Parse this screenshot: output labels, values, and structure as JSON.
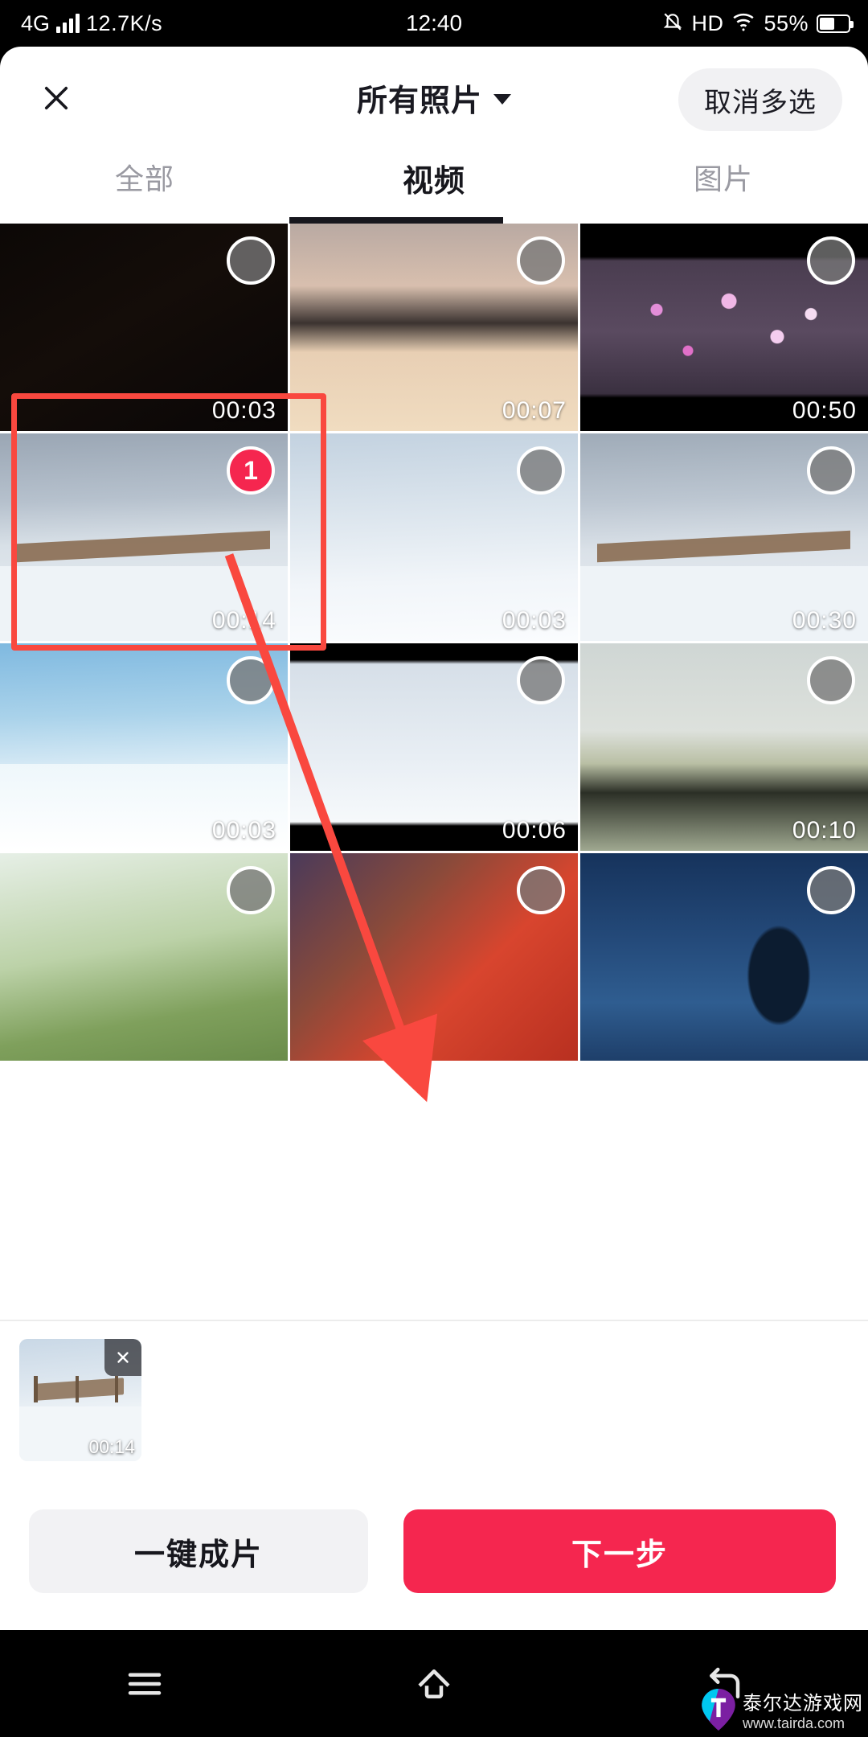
{
  "status_bar": {
    "network": "4G",
    "speed": "12.7K/s",
    "time": "12:40",
    "hd": "HD",
    "battery_pct": "55%",
    "icons": [
      "signal-bars-icon",
      "mute-bell-icon",
      "hd-icon",
      "wifi-icon",
      "battery-icon"
    ]
  },
  "header": {
    "close_icon": "close-icon",
    "title": "所有照片",
    "dropdown_icon": "chevron-down-icon",
    "cancel_multiselect_label": "取消多选"
  },
  "tabs": [
    {
      "label": "全部",
      "active": false
    },
    {
      "label": "视频",
      "active": true
    },
    {
      "label": "图片",
      "active": false
    }
  ],
  "grid": {
    "items": [
      {
        "duration": "00:03",
        "selected": false,
        "badge": "",
        "art": "dark-night"
      },
      {
        "duration": "00:07",
        "selected": false,
        "badge": "",
        "art": "winter-trees-reflection"
      },
      {
        "duration": "00:50",
        "selected": false,
        "badge": "",
        "art": "plum-blossom-night"
      },
      {
        "duration": "00:14",
        "selected": true,
        "badge": "1",
        "art": "snow-boardwalk"
      },
      {
        "duration": "00:03",
        "selected": false,
        "badge": "",
        "art": "snow-hill-tree"
      },
      {
        "duration": "00:30",
        "selected": false,
        "badge": "",
        "art": "snow-boardwalk-2"
      },
      {
        "duration": "00:03",
        "selected": false,
        "badge": "",
        "art": "cranes-snow-sky"
      },
      {
        "duration": "00:06",
        "selected": false,
        "badge": "",
        "art": "snow-field-fence"
      },
      {
        "duration": "00:10",
        "selected": false,
        "badge": "",
        "art": "lake-overcast"
      },
      {
        "duration": "",
        "selected": false,
        "badge": "",
        "art": "snow-branches-green"
      },
      {
        "duration": "",
        "selected": false,
        "badge": "",
        "art": "festival-lights-red"
      },
      {
        "duration": "",
        "selected": false,
        "badge": "",
        "art": "night-tree-stars"
      }
    ]
  },
  "selected_tray": {
    "thumb_duration": "00:14",
    "remove_icon": "close-icon",
    "art": "snow-boardwalk"
  },
  "bottom_actions": {
    "secondary_label": "一键成片",
    "primary_label": "下一步"
  },
  "nav_bar": {
    "menu_icon": "menu-icon",
    "home_icon": "home-icon",
    "back_icon": "back-icon"
  },
  "watermark": {
    "name": "泰尔达游戏网",
    "url": "www.tairda.com"
  },
  "colors": {
    "accent": "#f5264f",
    "annotation": "#f9483f",
    "tab_active": "#17171d",
    "tab_inactive": "#9a9aa2"
  }
}
